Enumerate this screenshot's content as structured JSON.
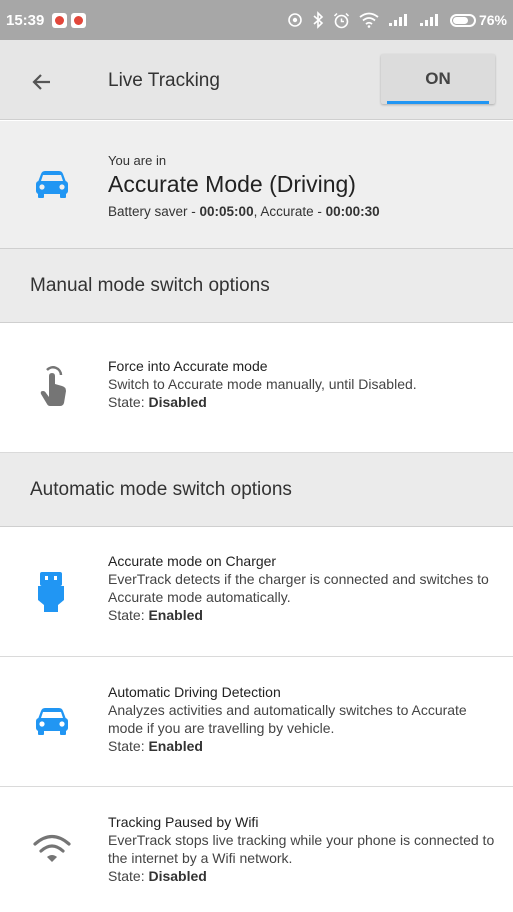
{
  "status_bar": {
    "time": "15:39",
    "battery_percent": "76%",
    "battery_level": 0.76
  },
  "app_bar": {
    "title": "Live Tracking",
    "toggle_label": "ON",
    "accent_color": "#2196f3"
  },
  "current_mode": {
    "prefix": "You are in",
    "mode_name": "Accurate Mode (Driving)",
    "battery_saver_label": "Battery saver - ",
    "battery_saver_value": "00:05:00",
    "accurate_label": ", Accurate - ",
    "accurate_value": "00:00:30",
    "icon": "car-icon"
  },
  "manual_section": {
    "header": "Manual mode switch options",
    "items": [
      {
        "icon": "touch-hand-icon",
        "title": "Force into Accurate mode",
        "description": "Switch to Accurate mode manually, until Disabled.",
        "state_label": "State: ",
        "state_value": "Disabled"
      }
    ]
  },
  "automatic_section": {
    "header": "Automatic mode switch options",
    "items": [
      {
        "icon": "usb-plug-icon",
        "title": "Accurate mode on Charger",
        "description": "EverTrack detects if the charger is connected and switches to Accurate mode automatically.",
        "state_label": "State: ",
        "state_value": "Enabled"
      },
      {
        "icon": "car-icon",
        "title": "Automatic Driving Detection",
        "description": "Analyzes activities and automatically switches to Accurate mode if you are travelling by vehicle.",
        "state_label": "State: ",
        "state_value": "Enabled"
      },
      {
        "icon": "wifi-icon",
        "title": "Tracking Paused by Wifi",
        "description": "EverTrack stops live tracking while your phone is connected to the internet by a Wifi network.",
        "state_label": "State: ",
        "state_value": "Disabled"
      }
    ]
  },
  "colors": {
    "icon_blue": "#2196f3",
    "icon_gray": "#757575"
  }
}
